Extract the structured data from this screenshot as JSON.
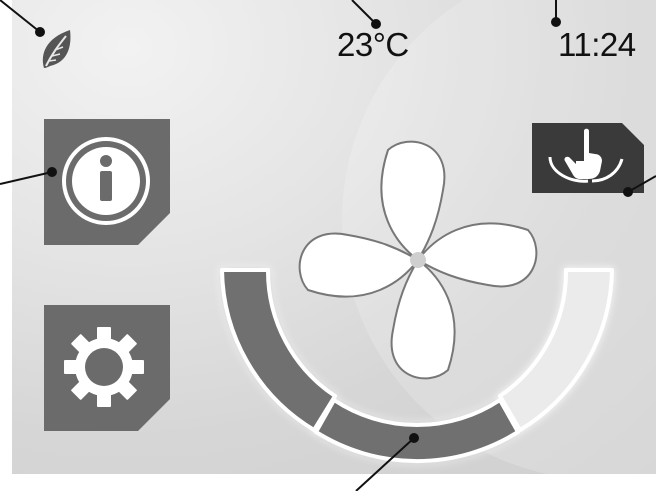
{
  "status_bar": {
    "temperature": "23°C",
    "clock": "11:24"
  },
  "icons": {
    "eco": "leaf-icon",
    "info": "info-icon",
    "settings": "gear-icon",
    "touch": "touch-gesture-icon",
    "fan": "fan-icon"
  },
  "fan_speed": {
    "levels": 3,
    "active_segments": 2
  },
  "colors": {
    "tile": "#6b6b6b",
    "touch_tile": "#3a3a3a",
    "arc_active": "#707070",
    "arc_inactive": "#ebebeb",
    "background": "#dcdcdc"
  }
}
